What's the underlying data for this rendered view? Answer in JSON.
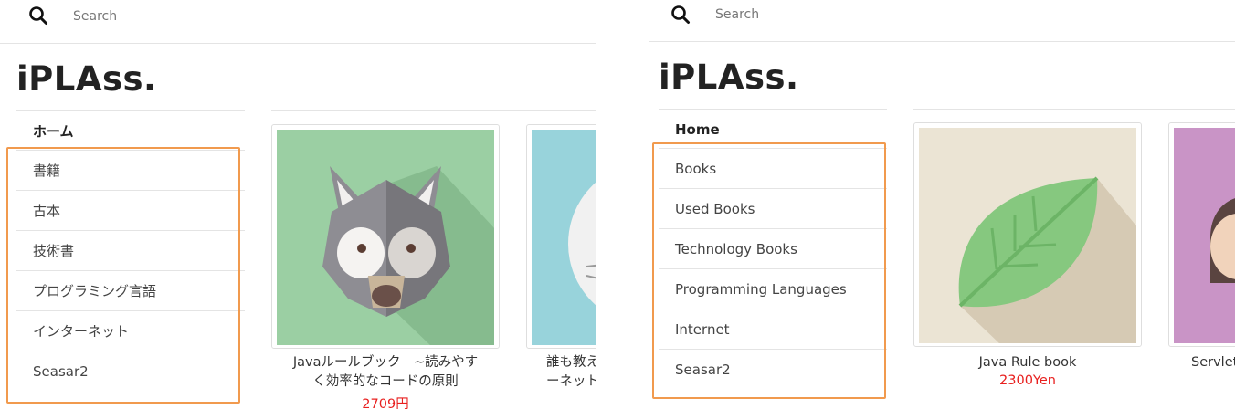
{
  "panel_ja": {
    "search": {
      "placeholder": "Search"
    },
    "logo": "iPLAss.",
    "nav": {
      "home": "ホーム",
      "items": [
        {
          "label": "書籍"
        },
        {
          "label": "古本"
        },
        {
          "label": "技術書"
        },
        {
          "label": "プログラミング言語"
        },
        {
          "label": "インターネット"
        },
        {
          "label": "Seasar2"
        }
      ]
    },
    "products": [
      {
        "title_line1": "Javaルールブック　~読みやす",
        "title_line2": "く効率的なコードの原則",
        "price": "2709円",
        "image": "wolf-illustration"
      },
      {
        "title_line1": "誰も教え",
        "title_line2": "ーネット",
        "image": "cat-illustration"
      }
    ]
  },
  "panel_en": {
    "search": {
      "placeholder": "Search"
    },
    "logo": "iPLAss.",
    "nav": {
      "home": "Home",
      "items": [
        {
          "label": "Books"
        },
        {
          "label": "Used Books"
        },
        {
          "label": "Technology Books"
        },
        {
          "label": "Programming Languages"
        },
        {
          "label": "Internet"
        },
        {
          "label": "Seasar2"
        }
      ]
    },
    "products": [
      {
        "title": "Java Rule book",
        "price": "2300Yen",
        "image": "leaf-illustration"
      },
      {
        "title": "Servlet",
        "image": "person-illustration"
      }
    ]
  },
  "colors": {
    "highlight": "#f19a4e",
    "price": "#e8201f",
    "divider": "#e4e4e4"
  }
}
